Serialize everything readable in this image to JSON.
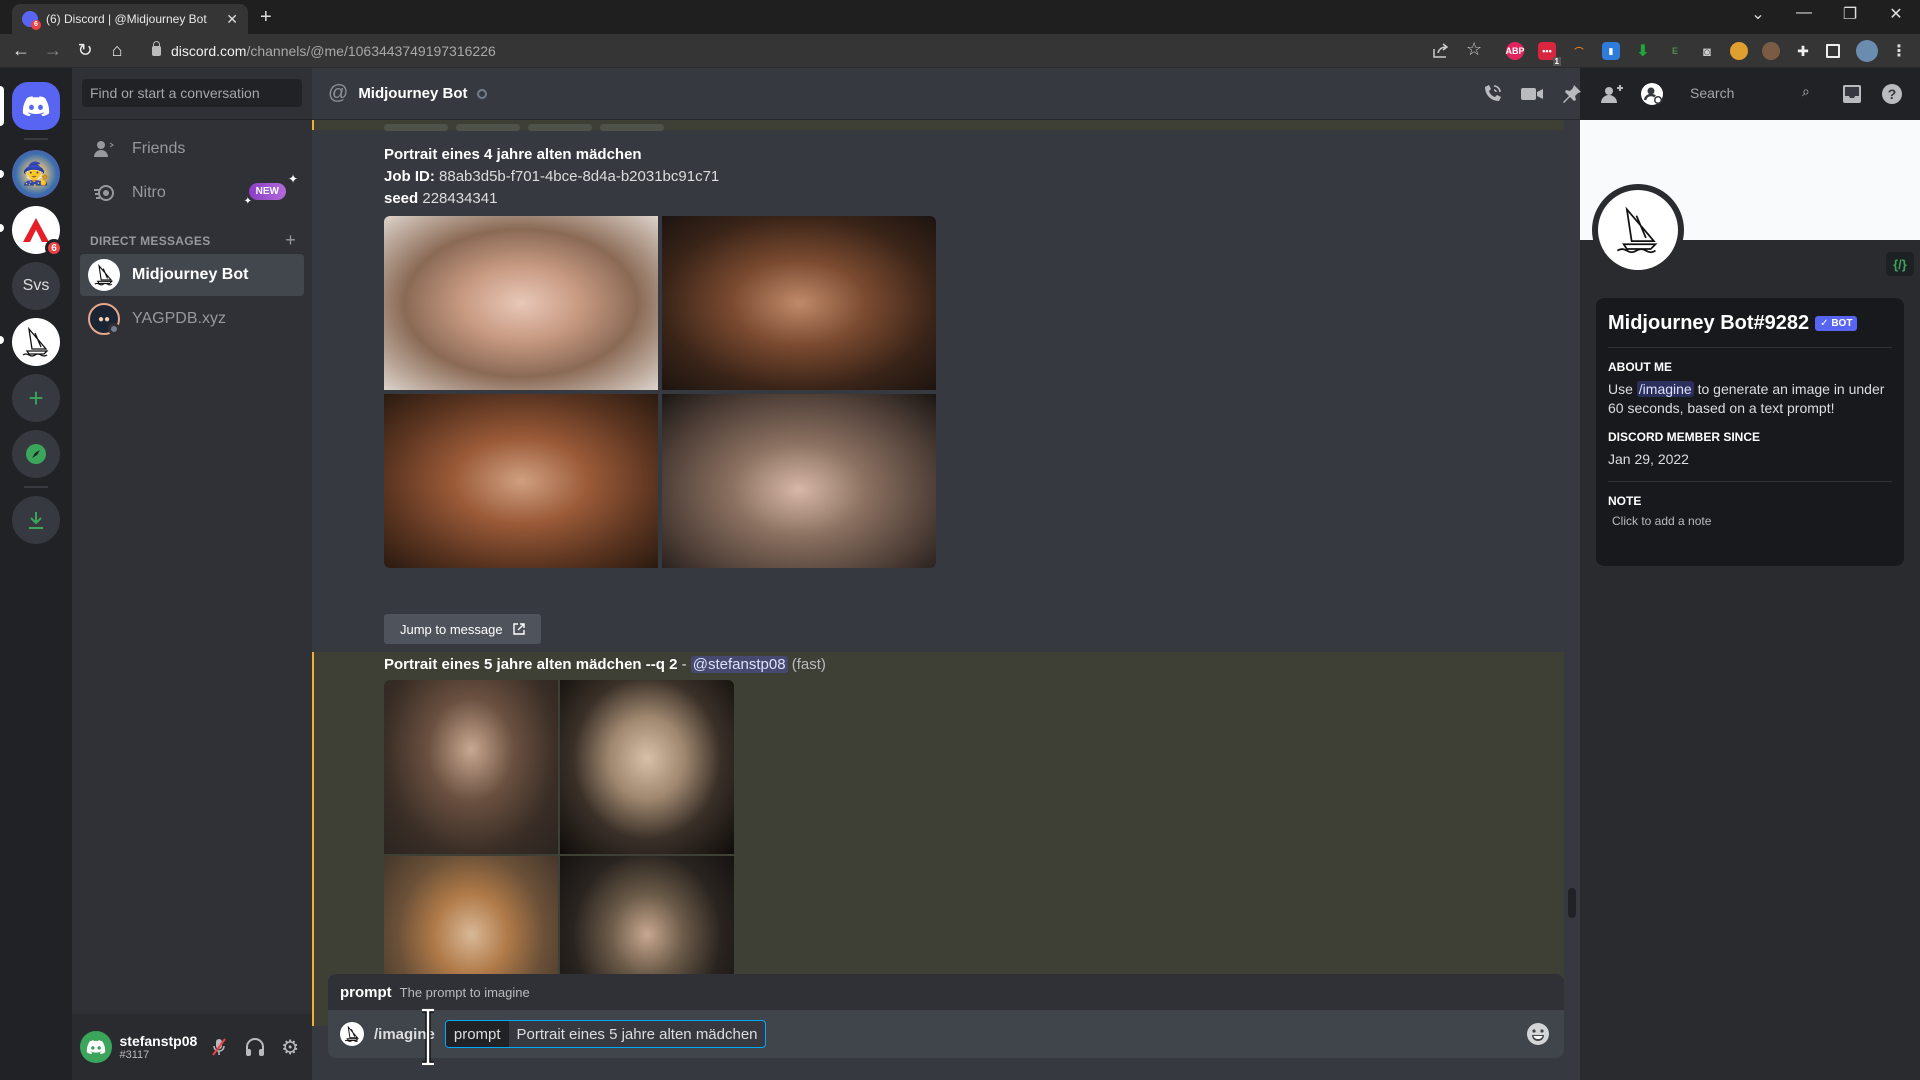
{
  "browser": {
    "tab_title": "(6) Discord | @Midjourney Bot",
    "tab_badge_count": "6",
    "url_domain": "discord.com",
    "url_path": "/channels/@me/1063443749197316226",
    "extension_badge": "1",
    "extensions": [
      "ABP",
      "todo-ext",
      "rainbow-ext",
      "bitwarden-ext",
      "download-ext",
      "e-ext",
      "camera-ext",
      "color-ext",
      "cookie-ext",
      "puzzle-ext"
    ]
  },
  "rail": {
    "servers": [
      {
        "name": "home",
        "label": ""
      },
      {
        "name": "server-avatar-wizard",
        "label": ""
      },
      {
        "name": "server-adobe",
        "label": "",
        "badge": "6"
      },
      {
        "name": "server-svs",
        "label": "Svs"
      },
      {
        "name": "server-midjourney",
        "label": ""
      }
    ],
    "add_server": "+",
    "colors": {
      "blurple": "#5865f2",
      "green": "#3ba55c",
      "red": "#ed4245"
    }
  },
  "dm_list": {
    "search_placeholder": "Find or start a conversation",
    "friends_label": "Friends",
    "nitro_label": "Nitro",
    "nitro_badge": "NEW",
    "section_header": "DIRECT MESSAGES",
    "dms": [
      {
        "name": "Midjourney Bot",
        "active": true
      },
      {
        "name": "YAGPDB.xyz",
        "active": false
      }
    ]
  },
  "user_panel": {
    "username": "stefanstp08",
    "discriminator": "#3117"
  },
  "chat": {
    "channel_title": "Midjourney Bot",
    "search_placeholder": "Search",
    "message1": {
      "prompt": "Portrait eines 4 jahre alten mädchen",
      "job_id_label": "Job ID",
      "job_id": "88ab3d5b-f701-4bce-8d4a-b2031bc91c71",
      "seed_label": "seed",
      "seed": "228434341",
      "jump_label": "Jump to message"
    },
    "message2": {
      "prompt": "Portrait eines 5 jahre alten mädchen --q 2",
      "separator": " - ",
      "mention": "@stefanstp08",
      "mode": "(fast)"
    },
    "autocomplete": {
      "option_name": "prompt",
      "option_desc": "The prompt to imagine"
    },
    "composer": {
      "command": "/imagine",
      "param_name": "prompt",
      "param_value": "Portrait eines 5 jahre alten mädchen"
    }
  },
  "profile": {
    "dev_badge": "{/}",
    "name": "Midjourney Bot#9282",
    "bot_badge": "✓ BOT",
    "about_title": "About me",
    "about_pre": "Use ",
    "about_cmd": "/imagine",
    "about_post": " to generate an image in under 60 seconds, based on a text prompt!",
    "member_since_title": "Discord member since",
    "member_since": "Jan 29, 2022",
    "note_title": "Note",
    "note_placeholder": "Click to add a note"
  }
}
